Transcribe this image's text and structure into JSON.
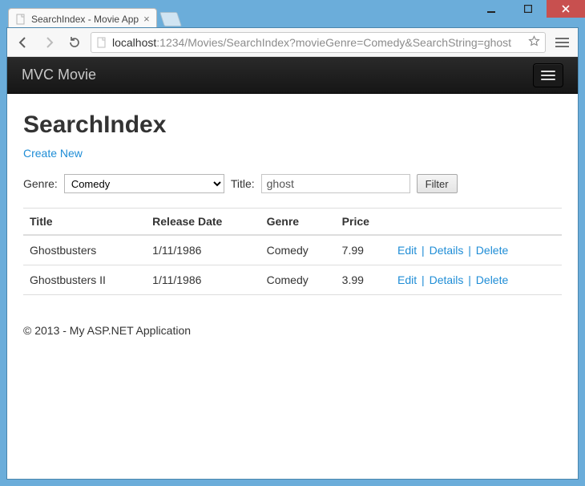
{
  "window": {
    "tab_title": "SearchIndex - Movie App",
    "url_host": "localhost",
    "url_rest": ":1234/Movies/SearchIndex?movieGenre=Comedy&SearchString=ghost"
  },
  "navbar": {
    "brand": "MVC Movie"
  },
  "page": {
    "heading": "SearchIndex",
    "create_link": "Create New",
    "genre_label": "Genre:",
    "title_label": "Title:",
    "genre_selected": "Comedy",
    "title_value": "ghost",
    "filter_button": "Filter"
  },
  "table": {
    "headers": {
      "title": "Title",
      "release": "Release Date",
      "genre": "Genre",
      "price": "Price"
    },
    "actions": {
      "edit": "Edit",
      "details": "Details",
      "delete": "Delete"
    },
    "rows": [
      {
        "title": "Ghostbusters",
        "release": "1/11/1986",
        "genre": "Comedy",
        "price": "7.99"
      },
      {
        "title": "Ghostbusters II",
        "release": "1/11/1986",
        "genre": "Comedy",
        "price": "3.99"
      }
    ]
  },
  "footer": {
    "text": "© 2013 - My ASP.NET Application"
  }
}
